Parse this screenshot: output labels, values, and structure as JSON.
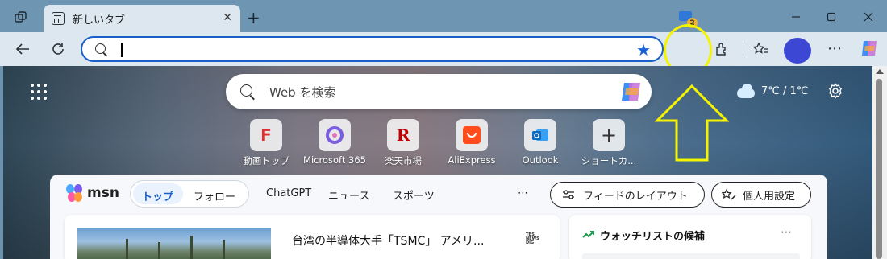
{
  "browser": {
    "tab": {
      "title": "新しいタブ"
    },
    "address": {
      "value": "",
      "placeholder": ""
    },
    "notification_badge": "2",
    "window_controls": [
      "minimize-icon",
      "maximize-icon",
      "close-icon"
    ]
  },
  "newtab": {
    "search": {
      "placeholder": "Web を検索"
    },
    "weather": {
      "text": "7℃ / 1℃",
      "icon": "cloud-icon"
    },
    "shortcuts": [
      {
        "label": "動画トップ",
        "icon": "F",
        "color": "#e02f2f"
      },
      {
        "label": "Microsoft 365",
        "icon": "m365-icon",
        "color": "#7a5ce0"
      },
      {
        "label": "楽天市場",
        "icon": "R",
        "color": "#bf0000"
      },
      {
        "label": "AliExpress",
        "icon": "aliexpress-icon",
        "color": "#ff4c1a"
      },
      {
        "label": "Outlook",
        "icon": "outlook-icon",
        "color": "#0f6cbd"
      },
      {
        "label": "ショートカ...",
        "icon": "+",
        "color": "#333333"
      }
    ]
  },
  "msn": {
    "logo": "msn",
    "tabs": [
      "トップ",
      "フォロー"
    ],
    "nav": [
      "ChatGPT",
      "ニュース",
      "スポーツ",
      "⋯"
    ],
    "feed_layout_button": "フィードのレイアウト",
    "personalize_button": "個人用設定",
    "news": {
      "title": "台湾の半導体大手「TSMC」 アメリ...",
      "source": "TBS NEWS DIG"
    },
    "watchlist": {
      "title": "ウォッチリストの候補",
      "more": "⋯"
    }
  },
  "colors": {
    "accent": "#1a5fc8",
    "highlight": "#f4f400"
  }
}
